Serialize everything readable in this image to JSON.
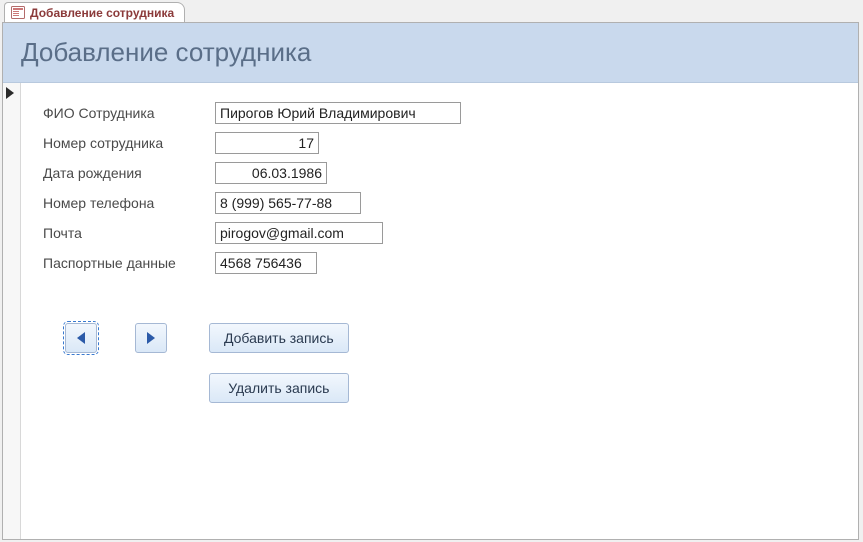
{
  "tab": {
    "title": "Добавление сотрудника"
  },
  "header": {
    "title": "Добавление сотрудника"
  },
  "fields": {
    "fullname": {
      "label": "ФИО Сотрудника",
      "value": "Пирогов Юрий Владимирович"
    },
    "emp_number": {
      "label": "Номер сотрудника",
      "value": "17"
    },
    "birthdate": {
      "label": "Дата рождения",
      "value": "06.03.1986"
    },
    "phone": {
      "label": "Номер телефона",
      "value": "8 (999) 565-77-88"
    },
    "email": {
      "label": "Почта",
      "value": "pirogov@gmail.com"
    },
    "passport": {
      "label": "Паспортные данные",
      "value": "4568 756436"
    }
  },
  "buttons": {
    "add": "Добавить запись",
    "delete": "Удалить запись"
  }
}
